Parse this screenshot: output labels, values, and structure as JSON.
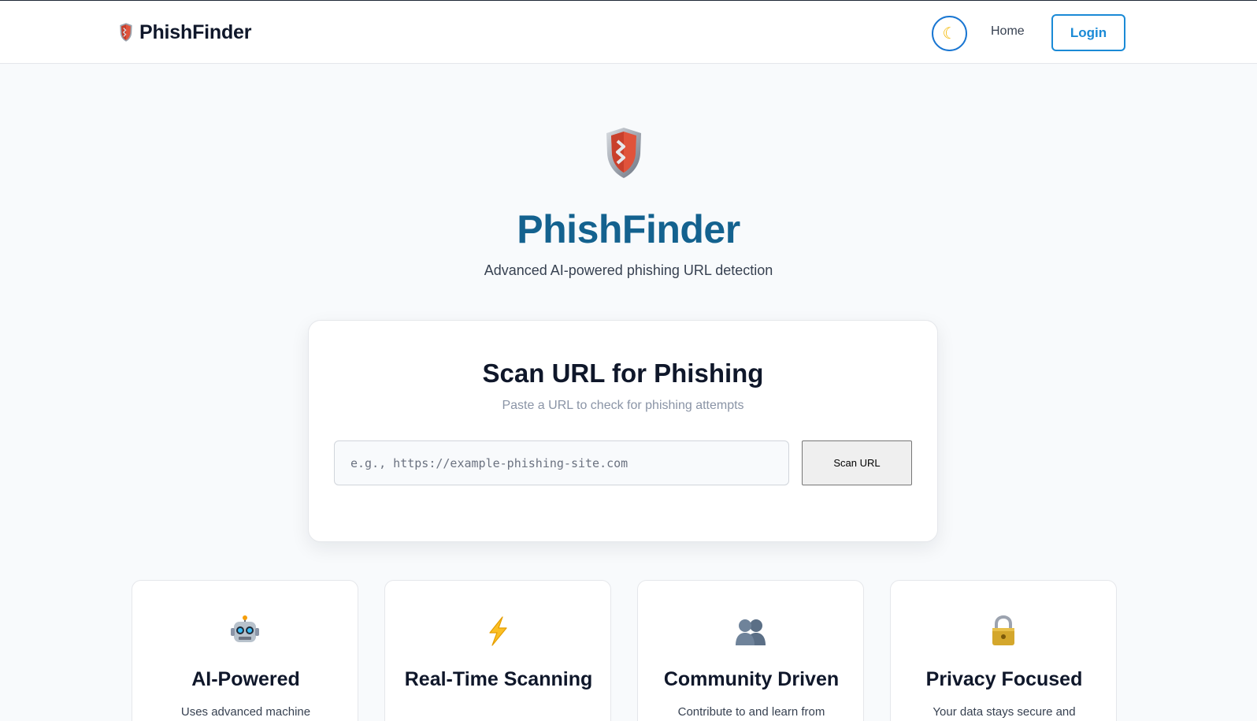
{
  "header": {
    "brand_name": "PhishFinder",
    "theme_toggle_icon": "moon-icon",
    "nav_home": "Home",
    "login_label": "Login"
  },
  "hero": {
    "title": "PhishFinder",
    "subtitle": "Advanced AI-powered phishing URL detection"
  },
  "scan": {
    "title": "Scan URL for Phishing",
    "subtitle": "Paste a URL to check for phishing attempts",
    "input_value": "",
    "input_placeholder": "e.g., https://example-phishing-site.com",
    "button_label": "Scan URL"
  },
  "features": [
    {
      "icon": "robot-icon",
      "title": "AI-Powered",
      "desc": "Uses advanced machine"
    },
    {
      "icon": "lightning-icon",
      "title": "Real-Time Scanning",
      "desc": ""
    },
    {
      "icon": "people-icon",
      "title": "Community Driven",
      "desc": "Contribute to and learn from"
    },
    {
      "icon": "lock-icon",
      "title": "Privacy Focused",
      "desc": "Your data stays secure and"
    }
  ],
  "colors": {
    "brand_primary": "#14628f",
    "accent_blue": "#1a8ad6",
    "shield_red": "#e0533b"
  }
}
